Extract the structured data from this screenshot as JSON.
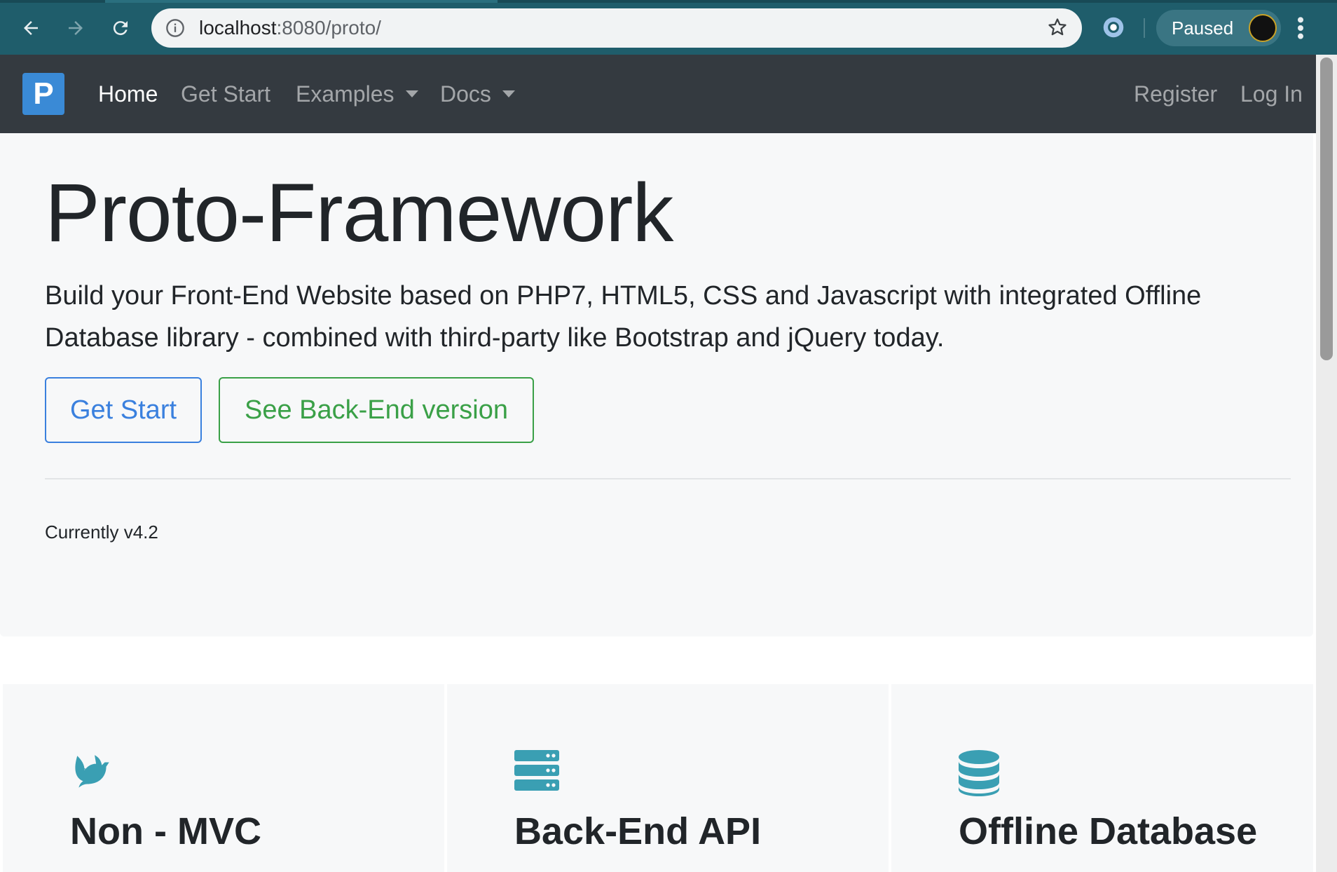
{
  "browser": {
    "url_host": "localhost",
    "url_rest": ":8080/proto/",
    "profile_status": "Paused"
  },
  "navbar": {
    "brand_letter": "P",
    "links": [
      {
        "label": "Home",
        "active": true
      },
      {
        "label": "Get Start"
      },
      {
        "label": "Examples",
        "dropdown": true
      },
      {
        "label": "Docs",
        "dropdown": true
      }
    ],
    "right_links": [
      {
        "label": "Register"
      },
      {
        "label": "Log In"
      }
    ]
  },
  "hero": {
    "title": "Proto-Framework",
    "lead": "Build your Front-End Website based on PHP7, HTML5, CSS and Javascript with integrated Offline Database library - combined with third-party like Bootstrap and jQuery today.",
    "primary_button": "Get Start",
    "secondary_button": "See Back-End version",
    "version_text": "Currently v4.2"
  },
  "features": [
    {
      "icon": "dove-icon",
      "title": "Non - MVC"
    },
    {
      "icon": "server-icon",
      "title": "Back-End API"
    },
    {
      "icon": "database-icon",
      "title": "Offline Database"
    }
  ],
  "colors": {
    "navbar_bg": "#343a40",
    "brand": "#3a8ad6",
    "primary": "#3a80de",
    "success": "#3aa047",
    "feature_icon": "#3a9fb3"
  }
}
